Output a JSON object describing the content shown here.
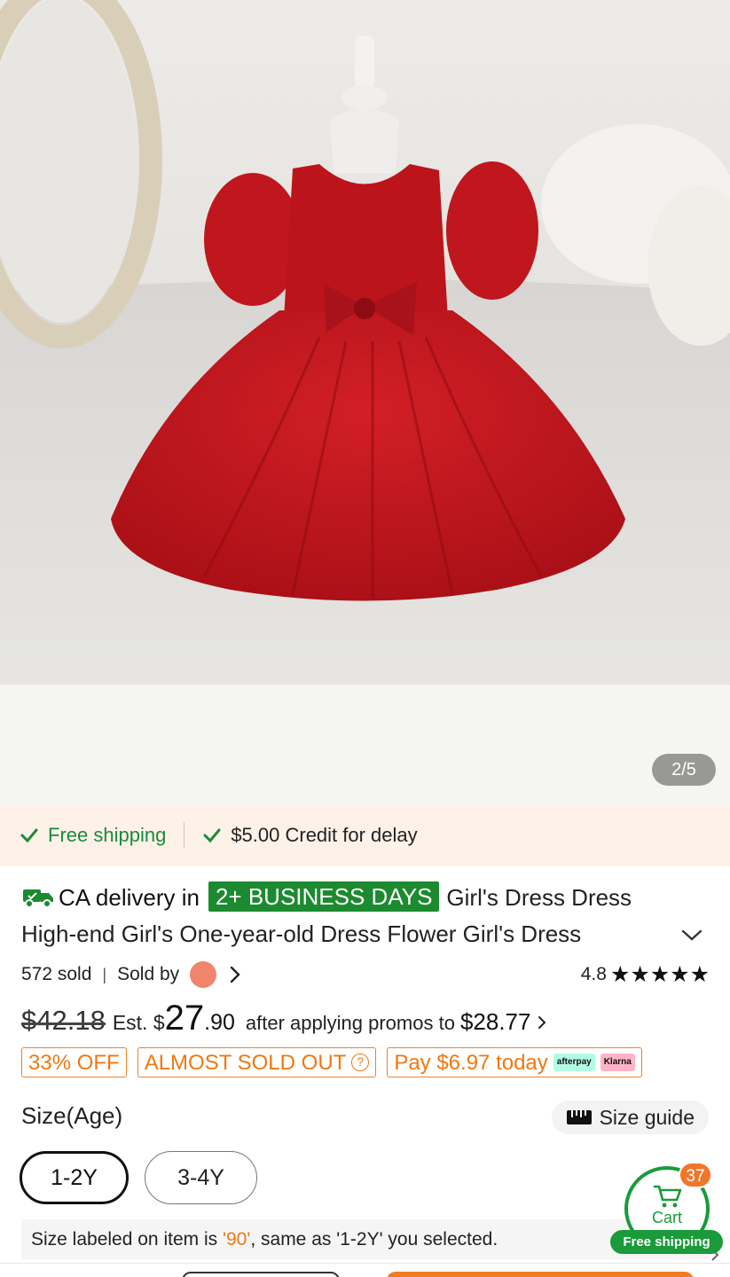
{
  "gallery": {
    "page_counter": "2/5"
  },
  "shipping": {
    "free_shipping": "Free shipping",
    "credit": "$5.00 Credit for delay"
  },
  "product": {
    "delivery_prefix": "CA delivery in",
    "delivery_badge": "2+ BUSINESS DAYS",
    "title": "Girl's Dress Dress High-end Girl's One-year-old Dress Flower Girl's Dress",
    "sold": "572 sold",
    "sold_by": "Sold by",
    "rating": "4.8",
    "stars": "★★★★★"
  },
  "price": {
    "original": "$42.18",
    "est_label": "Est. $",
    "est_dollars": "27",
    "est_cents": ".90",
    "promo_text": "after applying promos to",
    "promo_price": "$28.77"
  },
  "tags": {
    "discount": "33% OFF",
    "almost_sold_out": "ALMOST SOLD OUT",
    "pay_today": "Pay $6.97 today",
    "afterpay_logo": "afterpay",
    "klarna_logo": "Klarna"
  },
  "size": {
    "label": "Size(Age)",
    "guide": "Size guide",
    "options": [
      "1-2Y",
      "3-4Y"
    ],
    "selected": "1-2Y",
    "note_prefix": "Size labeled on item is ",
    "note_value": "'90'",
    "note_suffix": ", same as '1-2Y' you selected."
  },
  "cart": {
    "label": "Cart",
    "count": "37",
    "free_shipping": "Free shipping"
  },
  "colors": {
    "green": "#1a9a3a",
    "orange": "#f07812",
    "dress_red": "#c0161d",
    "shipping_bg": "#fdf1e8"
  }
}
